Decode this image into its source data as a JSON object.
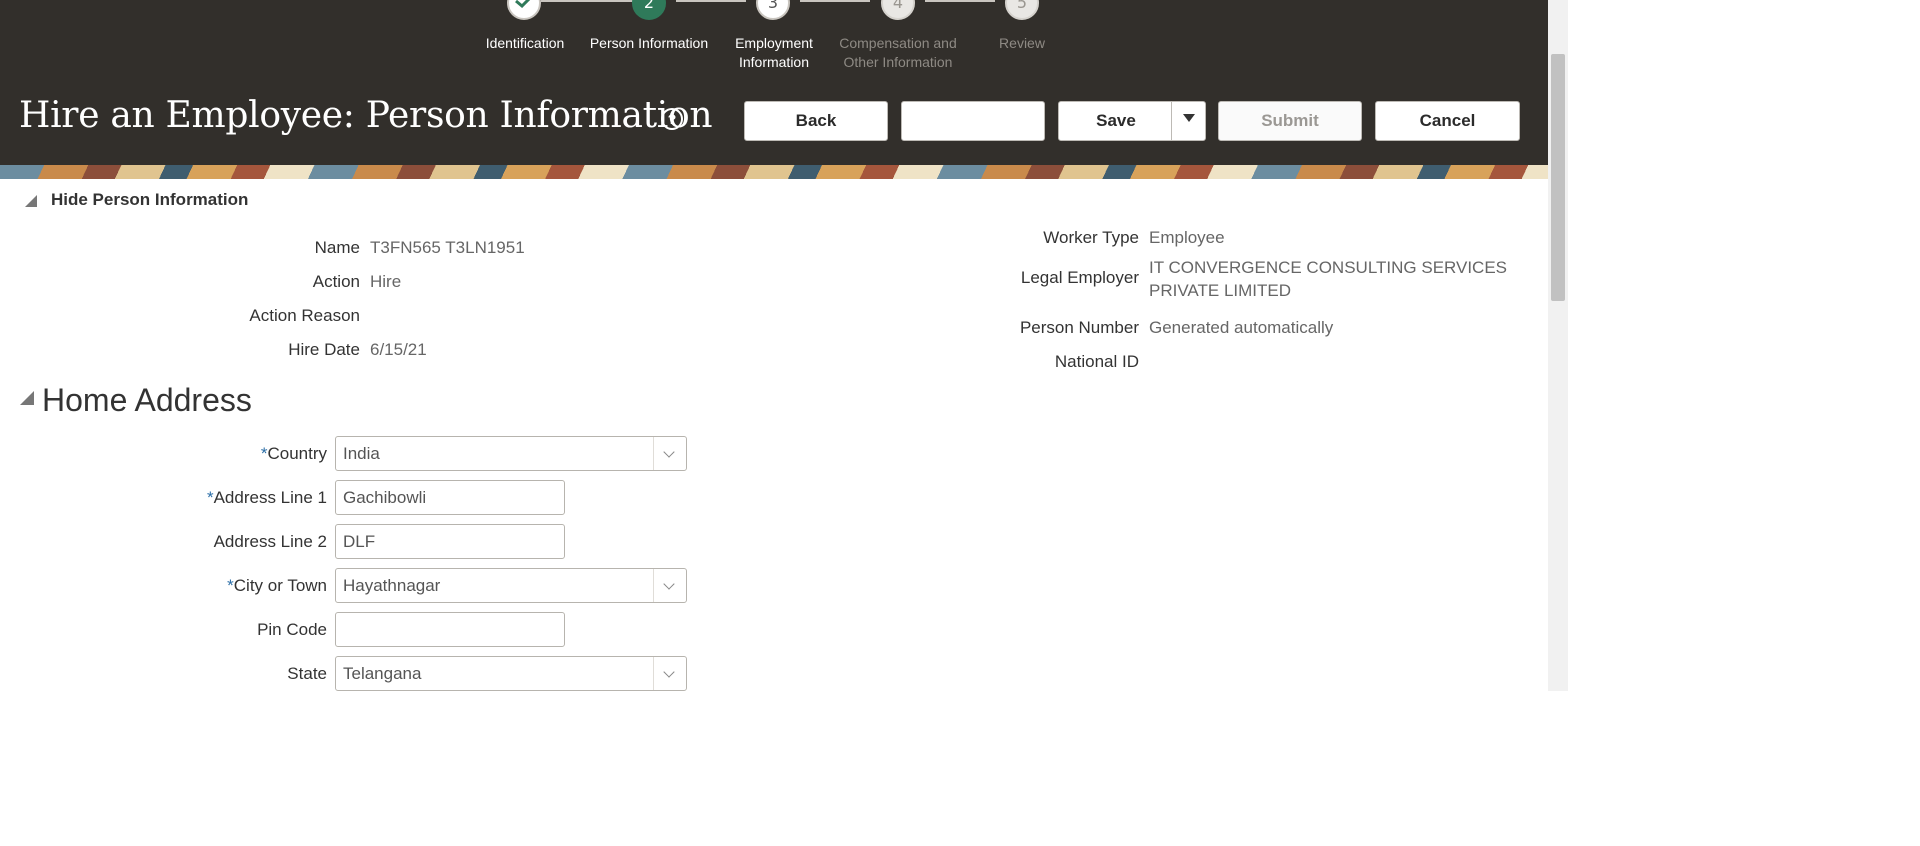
{
  "train": {
    "steps": [
      {
        "number": "",
        "label": "Identification",
        "status": "done"
      },
      {
        "number": "2",
        "label": "Person Information",
        "status": "current"
      },
      {
        "number": "3",
        "label_line1": "Employment",
        "label_line2": "Information",
        "status": "next"
      },
      {
        "number": "4",
        "label_line1": "Compensation and",
        "label_line2": "Other Information",
        "status": "future"
      },
      {
        "number": "5",
        "label": "Review",
        "status": "future"
      }
    ]
  },
  "header": {
    "title": "Hire an Employee: Person Information",
    "help_icon": "?",
    "buttons": {
      "back": "Back",
      "blank": "",
      "save": "Save",
      "submit": "Submit",
      "cancel": "Cancel"
    }
  },
  "person_section": {
    "toggle_label": "Hide Person Information",
    "left": {
      "name_label": "Name",
      "name_value": "T3FN565 T3LN1951",
      "action_label": "Action",
      "action_value": "Hire",
      "action_reason_label": "Action Reason",
      "action_reason_value": "",
      "hire_date_label": "Hire Date",
      "hire_date_value": "6/15/21"
    },
    "right": {
      "worker_type_label": "Worker Type",
      "worker_type_value": "Employee",
      "legal_employer_label": "Legal Employer",
      "legal_employer_value_line1": "IT CONVERGENCE CONSULTING SERVICES",
      "legal_employer_value_line2": "PRIVATE LIMITED",
      "person_number_label": "Person Number",
      "person_number_value": "Generated automatically",
      "national_id_label": "National ID",
      "national_id_value": ""
    }
  },
  "home_address": {
    "title": "Home Address",
    "required_mark": "*",
    "fields": {
      "country_label": "Country",
      "country_value": "India",
      "address1_label": "Address Line 1",
      "address1_value": "Gachibowli",
      "address2_label": "Address Line 2",
      "address2_value": "DLF",
      "city_label": "City or Town",
      "city_value": "Hayathnagar",
      "pin_label": "Pin Code",
      "pin_value": "",
      "state_label": "State",
      "state_value": "Telangana"
    }
  },
  "colors": {
    "header_bg": "#322f2b",
    "current_step": "#2f7a5a",
    "required": "#2b6ea7"
  }
}
